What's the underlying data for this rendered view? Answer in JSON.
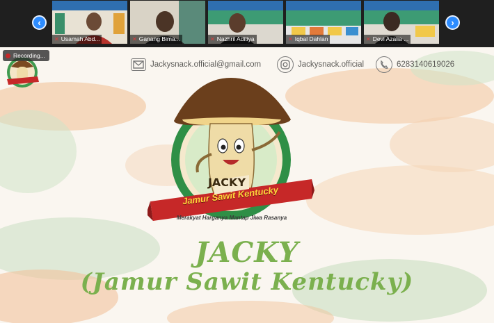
{
  "participants": [
    {
      "name": "Usamah Abd..."
    },
    {
      "name": "Ganang Bima..."
    },
    {
      "name": "Nazhril Aditiya"
    },
    {
      "name": "Iqbal Dahlan"
    },
    {
      "name": "Devi Azalia ..."
    }
  ],
  "recording": {
    "label": "Recording..."
  },
  "contact": {
    "email": "Jackysnack.official@gmail.com",
    "instagram": "Jackysnack.official",
    "phone": "6283140619026"
  },
  "slide": {
    "logo_brand": "JACKY",
    "ribbon_text": "Jamur Sawit Kentucky",
    "tagline": "Merakyat Harganya Mantap Jiwa Rasanya",
    "title_line1": "JACKY",
    "title_line2": "(Jamur Sawit Kentucky)"
  },
  "colors": {
    "zoom_blue": "#2d8cff",
    "title_green": "#7bb04e",
    "logo_green": "#2f8f46",
    "ribbon_red": "#c62828"
  }
}
